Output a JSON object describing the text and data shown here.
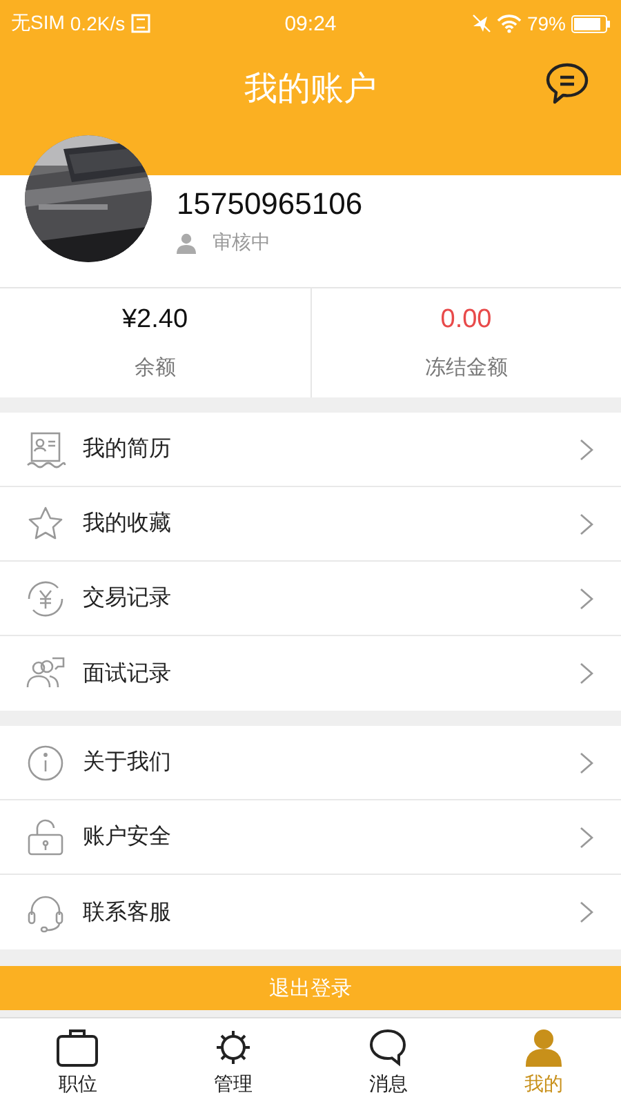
{
  "status_bar": {
    "carrier": "无SIM",
    "speed": "0.2K/s",
    "time": "09:24",
    "battery": "79%"
  },
  "header": {
    "title": "我的账户"
  },
  "profile": {
    "phone": "15750965106",
    "status": "审核中"
  },
  "balances": [
    {
      "value": "¥2.40",
      "label": "余额",
      "kind": "normal"
    },
    {
      "value": "0.00",
      "label": "冻结金额",
      "kind": "frozen"
    }
  ],
  "menu_groups": [
    [
      {
        "label": "我的简历"
      },
      {
        "label": "我的收藏"
      },
      {
        "label": "交易记录"
      },
      {
        "label": "面试记录"
      }
    ],
    [
      {
        "label": "关于我们"
      },
      {
        "label": "账户安全"
      },
      {
        "label": "联系客服"
      }
    ]
  ],
  "logout_button": "退出登录",
  "tab_bar": [
    {
      "label": "职位",
      "selected": false
    },
    {
      "label": "管理",
      "selected": false
    },
    {
      "label": "消息",
      "selected": false
    },
    {
      "label": "我的",
      "selected": true
    }
  ]
}
